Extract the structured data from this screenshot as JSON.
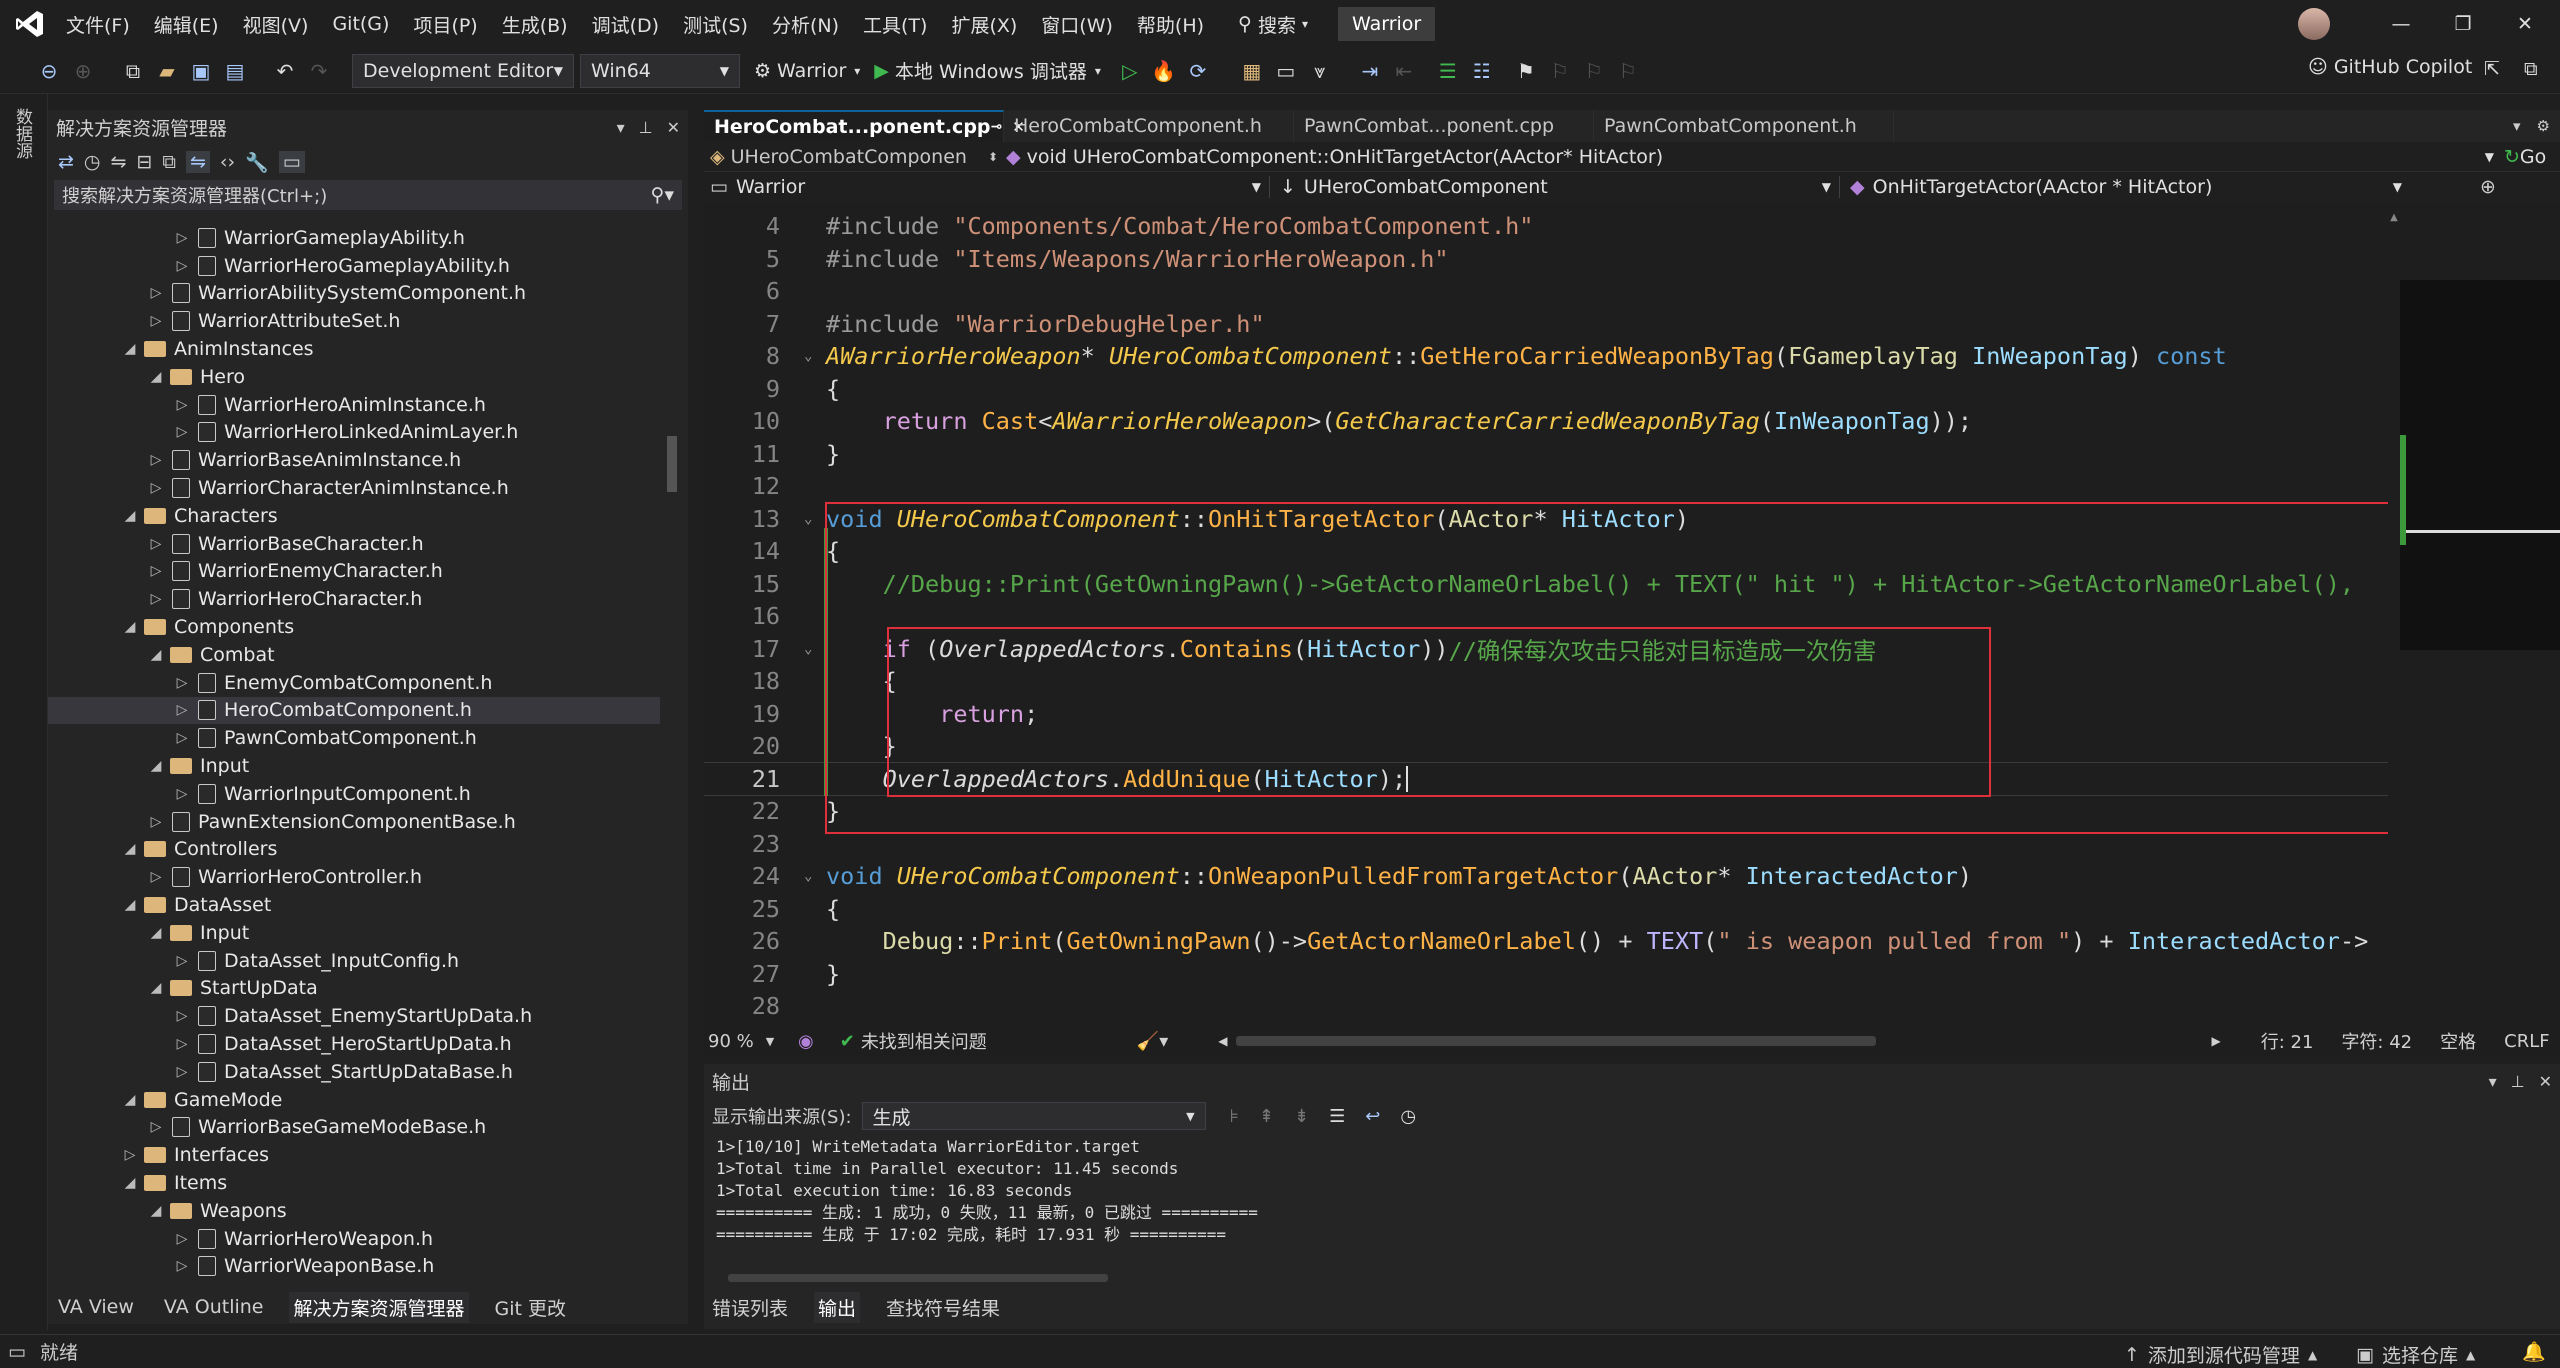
{
  "menu": [
    "文件(F)",
    "编辑(E)",
    "视图(V)",
    "Git(G)",
    "项目(P)",
    "生成(B)",
    "调试(D)",
    "测试(S)",
    "分析(N)",
    "工具(T)",
    "扩展(X)",
    "窗口(W)",
    "帮助(H)"
  ],
  "search_label": "搜索",
  "solution_name": "Warrior",
  "toolbar": {
    "config": "Development Editor",
    "platform": "Win64",
    "startup_project": "Warrior",
    "debugger": "本地 Windows 调试器",
    "copilot": "GitHub Copilot"
  },
  "left_strip_label": "数据源",
  "solution_explorer": {
    "title": "解决方案资源管理器",
    "search_placeholder": "搜索解决方案资源管理器(Ctrl+;)",
    "items": [
      {
        "label": "WarriorGameplayAbility.h",
        "depth": 4,
        "kind": "file",
        "expander": "▷"
      },
      {
        "label": "WarriorHeroGameplayAbility.h",
        "depth": 4,
        "kind": "file",
        "expander": "▷"
      },
      {
        "label": "WarriorAbilitySystemComponent.h",
        "depth": 3,
        "kind": "file",
        "expander": "▷"
      },
      {
        "label": "WarriorAttributeSet.h",
        "depth": 3,
        "kind": "file",
        "expander": "▷"
      },
      {
        "label": "AnimInstances",
        "depth": 2,
        "kind": "folder",
        "expander": "◢"
      },
      {
        "label": "Hero",
        "depth": 3,
        "kind": "folder",
        "expander": "◢"
      },
      {
        "label": "WarriorHeroAnimInstance.h",
        "depth": 4,
        "kind": "file",
        "expander": "▷"
      },
      {
        "label": "WarriorHeroLinkedAnimLayer.h",
        "depth": 4,
        "kind": "file",
        "expander": "▷"
      },
      {
        "label": "WarriorBaseAnimInstance.h",
        "depth": 3,
        "kind": "file",
        "expander": "▷"
      },
      {
        "label": "WarriorCharacterAnimInstance.h",
        "depth": 3,
        "kind": "file",
        "expander": "▷"
      },
      {
        "label": "Characters",
        "depth": 2,
        "kind": "folder",
        "expander": "◢"
      },
      {
        "label": "WarriorBaseCharacter.h",
        "depth": 3,
        "kind": "file",
        "expander": "▷"
      },
      {
        "label": "WarriorEnemyCharacter.h",
        "depth": 3,
        "kind": "file",
        "expander": "▷"
      },
      {
        "label": "WarriorHeroCharacter.h",
        "depth": 3,
        "kind": "file",
        "expander": "▷"
      },
      {
        "label": "Components",
        "depth": 2,
        "kind": "folder",
        "expander": "◢"
      },
      {
        "label": "Combat",
        "depth": 3,
        "kind": "folder",
        "expander": "◢"
      },
      {
        "label": "EnemyCombatComponent.h",
        "depth": 4,
        "kind": "file",
        "expander": "▷"
      },
      {
        "label": "HeroCombatComponent.h",
        "depth": 4,
        "kind": "file",
        "expander": "▷",
        "selected": true
      },
      {
        "label": "PawnCombatComponent.h",
        "depth": 4,
        "kind": "file",
        "expander": "▷"
      },
      {
        "label": "Input",
        "depth": 3,
        "kind": "folder",
        "expander": "◢"
      },
      {
        "label": "WarriorInputComponent.h",
        "depth": 4,
        "kind": "file",
        "expander": "▷"
      },
      {
        "label": "PawnExtensionComponentBase.h",
        "depth": 3,
        "kind": "file",
        "expander": "▷"
      },
      {
        "label": "Controllers",
        "depth": 2,
        "kind": "folder",
        "expander": "◢"
      },
      {
        "label": "WarriorHeroController.h",
        "depth": 3,
        "kind": "file",
        "expander": "▷"
      },
      {
        "label": "DataAsset",
        "depth": 2,
        "kind": "folder",
        "expander": "◢"
      },
      {
        "label": "Input",
        "depth": 3,
        "kind": "folder",
        "expander": "◢"
      },
      {
        "label": "DataAsset_InputConfig.h",
        "depth": 4,
        "kind": "file",
        "expander": "▷"
      },
      {
        "label": "StartUpData",
        "depth": 3,
        "kind": "folder",
        "expander": "◢"
      },
      {
        "label": "DataAsset_EnemyStartUpData.h",
        "depth": 4,
        "kind": "file",
        "expander": "▷"
      },
      {
        "label": "DataAsset_HeroStartUpData.h",
        "depth": 4,
        "kind": "file",
        "expander": "▷"
      },
      {
        "label": "DataAsset_StartUpDataBase.h",
        "depth": 4,
        "kind": "file",
        "expander": "▷"
      },
      {
        "label": "GameMode",
        "depth": 2,
        "kind": "folder",
        "expander": "◢"
      },
      {
        "label": "WarriorBaseGameModeBase.h",
        "depth": 3,
        "kind": "file",
        "expander": "▷"
      },
      {
        "label": "Interfaces",
        "depth": 2,
        "kind": "folder",
        "expander": "▷"
      },
      {
        "label": "Items",
        "depth": 2,
        "kind": "folder",
        "expander": "◢"
      },
      {
        "label": "Weapons",
        "depth": 3,
        "kind": "folder",
        "expander": "◢"
      },
      {
        "label": "WarriorHeroWeapon.h",
        "depth": 4,
        "kind": "file",
        "expander": "▷"
      },
      {
        "label": "WarriorWeaponBase.h",
        "depth": 4,
        "kind": "file",
        "expander": "▷"
      }
    ],
    "bottom_tabs": [
      "VA View",
      "VA Outline",
      "解决方案资源管理器",
      "Git 更改"
    ]
  },
  "editor": {
    "tabs": [
      {
        "label": "HeroCombat...ponent.cpp",
        "active": true
      },
      {
        "label": "HeroCombatComponent.h"
      },
      {
        "label": "PawnCombat...ponent.cpp"
      },
      {
        "label": "PawnCombatComponent.h"
      }
    ],
    "nav_class": "UHeroCombatComponen",
    "nav_member": "void UHeroCombatComponent::OnHitTargetActor(AActor* HitActor)",
    "nav_go": "Go",
    "nav_project": "Warrior",
    "nav_scope": "UHeroCombatComponent",
    "nav_function": "OnHitTargetActor(AActor * HitActor)",
    "line_numbers": [
      "4",
      "5",
      "6",
      "7",
      "8",
      "9",
      "10",
      "11",
      "12",
      "13",
      "14",
      "15",
      "16",
      "17",
      "18",
      "19",
      "20",
      "21",
      "22",
      "23",
      "24",
      "25",
      "26",
      "27",
      "28"
    ],
    "current_line": "21",
    "status": {
      "zoom": "90 %",
      "issues": "未找到相关问题",
      "line": "行: 21",
      "char": "字符: 42",
      "spaces": "空格",
      "eol": "CRLF"
    }
  },
  "output": {
    "title": "输出",
    "source_label": "显示输出来源(S):",
    "source_value": "生成",
    "lines": [
      "1>[10/10] WriteMetadata WarriorEditor.target",
      "1>Total time in Parallel executor: 11.45 seconds",
      "1>Total execution time: 16.83 seconds",
      "========== 生成: 1 成功，0 失败，11 最新，0 已跳过 ==========",
      "========== 生成 于 17:02 完成，耗时 17.931 秒 =========="
    ],
    "tabs": [
      "错误列表",
      "输出",
      "查找符号结果"
    ]
  },
  "statusbar": {
    "ready": "就绪",
    "source_control": "添加到源代码管理",
    "repo": "选择仓库"
  },
  "colors": {
    "accent": "#0e639c",
    "highlight_box": "#e0303c",
    "change_bar": "#3c9a3c"
  }
}
